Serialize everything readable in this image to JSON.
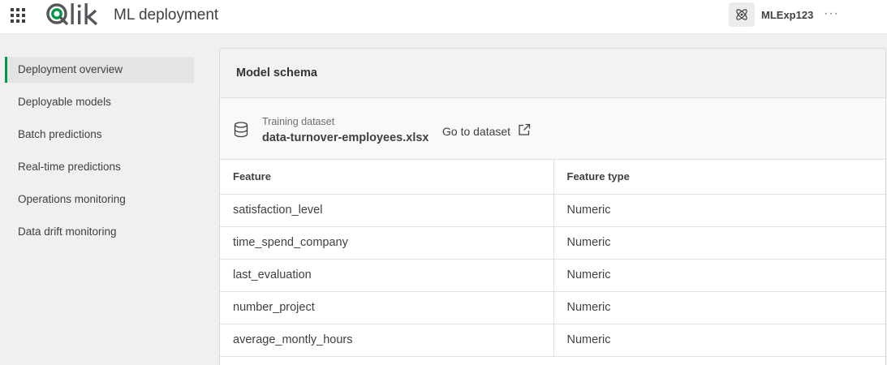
{
  "header": {
    "logo_text": "Qlik",
    "app_title": "ML deployment",
    "experiment_name": "MLExp123",
    "more_label": "···",
    "icons": {
      "app_switcher": "grid-icon",
      "experiment": "atom-icon",
      "more": "more-dots-icon"
    },
    "brand_color": "#009845"
  },
  "sidebar": {
    "items": [
      {
        "label": "Deployment overview",
        "active": true
      },
      {
        "label": "Deployable models",
        "active": false
      },
      {
        "label": "Batch predictions",
        "active": false
      },
      {
        "label": "Real-time predictions",
        "active": false
      },
      {
        "label": "Operations monitoring",
        "active": false
      },
      {
        "label": "Data drift monitoring",
        "active": false
      }
    ]
  },
  "schema": {
    "title": "Model schema",
    "dataset_label": "Training dataset",
    "dataset_file": "data-turnover-employees.xlsx",
    "goto_label": "Go to dataset",
    "columns": [
      "Feature",
      "Feature type"
    ],
    "rows": [
      [
        "satisfaction_level",
        "Numeric"
      ],
      [
        "time_spend_company",
        "Numeric"
      ],
      [
        "last_evaluation",
        "Numeric"
      ],
      [
        "number_project",
        "Numeric"
      ],
      [
        "average_montly_hours",
        "Numeric"
      ]
    ]
  }
}
